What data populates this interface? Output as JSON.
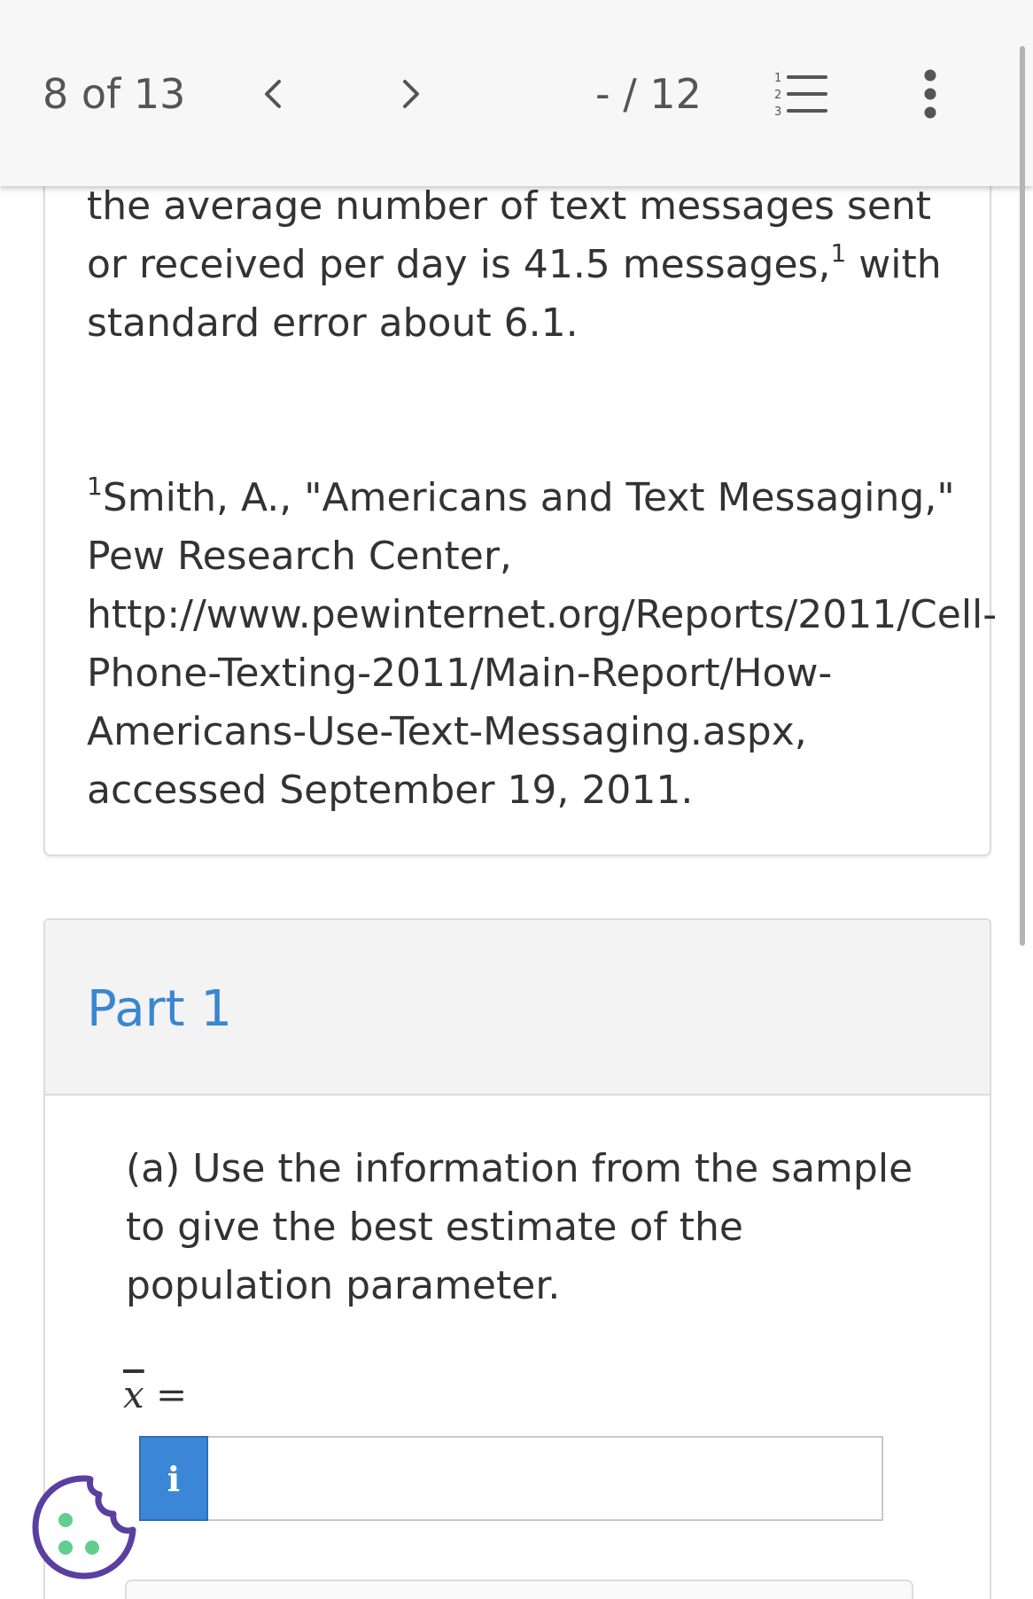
{
  "header": {
    "question_counter": "8 of 13",
    "score": "- / 12"
  },
  "icons": {
    "prev": "chevron-left-icon",
    "next": "chevron-right-icon",
    "list": "numbered-list-icon",
    "more": "more-vertical-icon",
    "info": "info-icon",
    "cookie": "cookie-icon"
  },
  "problem": {
    "text_before_sup": "the average number of text messages sent or received per day is 41.5 messages,",
    "sup": "1",
    "text_after_sup": " with standard error about 6.1.",
    "footnote": {
      "marker": "1",
      "lines": [
        "Smith, A., \"Americans and Text Messaging,\"",
        "Pew Research Center,",
        "http://www.pewinternet.org/Reports/2011/Cell-",
        "Phone-Texting-2011/Main-Report/How-",
        "Americans-Use-Text-Messaging.aspx,",
        "accessed September 19, 2011."
      ]
    }
  },
  "part1": {
    "title": "Part 1",
    "question": "(a) Use the information from the sample to give the best estimate of the population parameter.",
    "answer_label_symbol": "x",
    "answer_label_equals": "=",
    "info_button_label": "i",
    "answer_value": ""
  },
  "colors": {
    "accent": "#3b86d1",
    "info_button": "#3b86d6",
    "cookie_outline": "#5a3fa0",
    "cookie_dots": "#5fce8f"
  }
}
